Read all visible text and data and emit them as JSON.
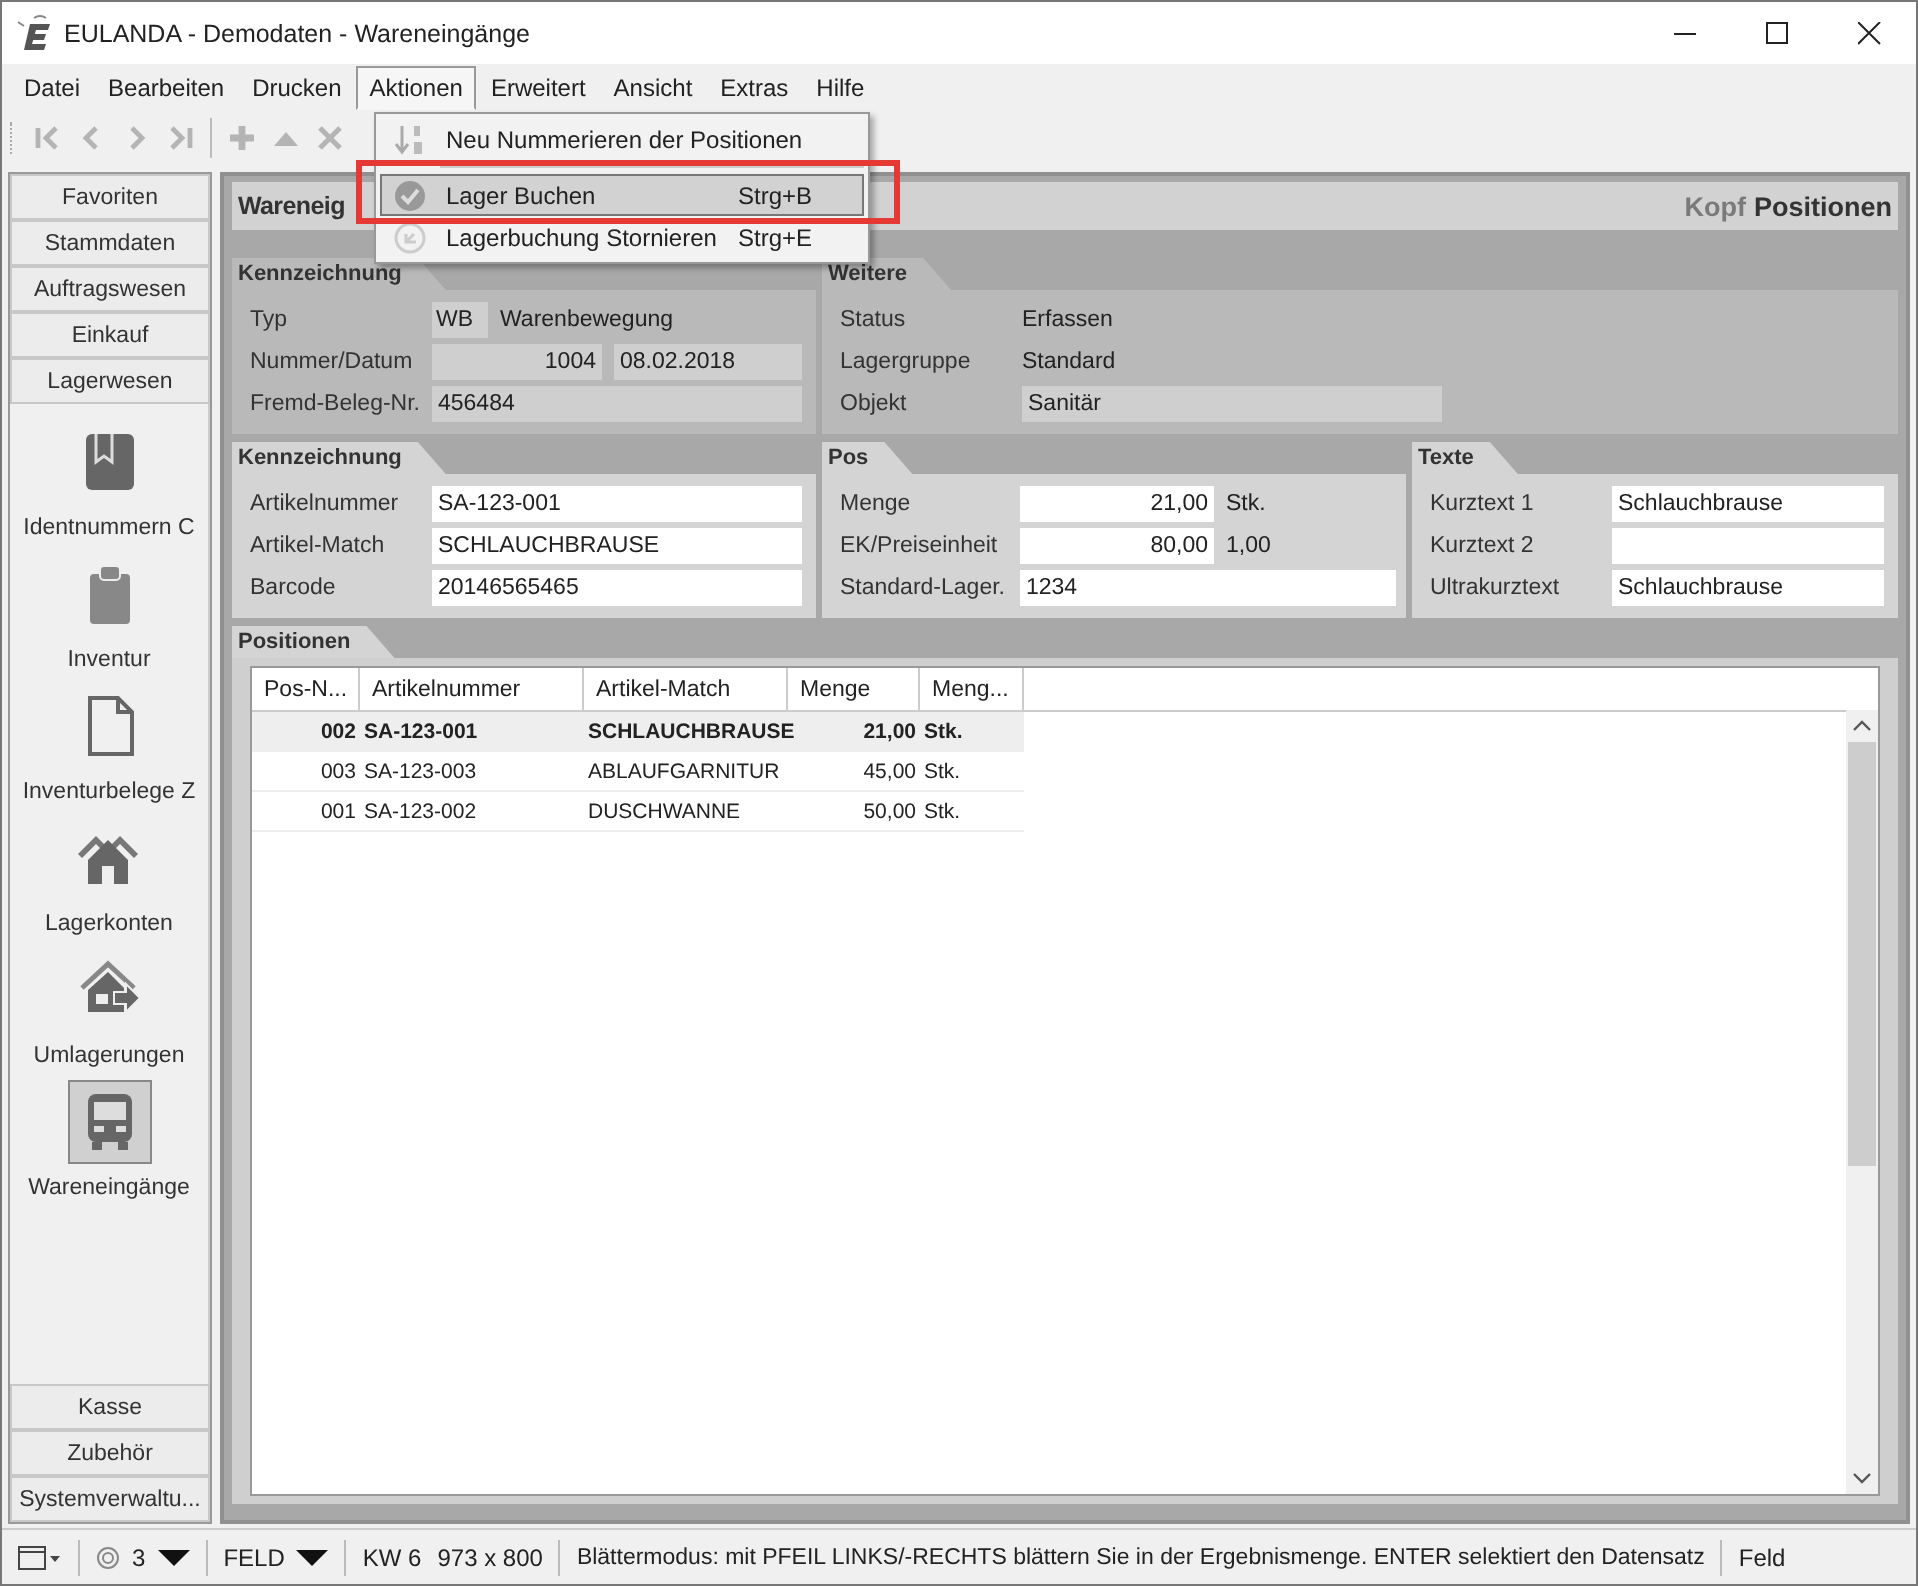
{
  "window": {
    "title": "EULANDA - Demodaten - Wareneingänge"
  },
  "menu": [
    {
      "label": "Datei",
      "selected": false
    },
    {
      "label": "Bearbeiten",
      "selected": false
    },
    {
      "label": "Drucken",
      "selected": false
    },
    {
      "label": "Aktionen",
      "selected": true
    },
    {
      "label": "Erweitert",
      "selected": false
    },
    {
      "label": "Ansicht",
      "selected": false
    },
    {
      "label": "Extras",
      "selected": false
    },
    {
      "label": "Hilfe",
      "selected": false
    }
  ],
  "dropdown": [
    {
      "kind": "item",
      "label": "Neu Nummerieren der Positionen",
      "selected": false
    },
    {
      "kind": "separator"
    },
    {
      "kind": "item",
      "label": "Lager Buchen",
      "shortcut": "Strg+B",
      "selected": true
    },
    {
      "kind": "item",
      "label": "Lagerbuchung Stornieren",
      "shortcut": "Strg+E",
      "selected": false
    }
  ],
  "toolbar": [
    {
      "kind": "first",
      "disabled": true
    },
    {
      "kind": "prev",
      "disabled": true
    },
    {
      "kind": "next",
      "disabled": true
    },
    {
      "kind": "last",
      "disabled": true
    },
    {
      "kind": "separator"
    },
    {
      "kind": "add",
      "disabled": true
    },
    {
      "kind": "up",
      "disabled": true
    },
    {
      "kind": "delete",
      "disabled": true
    }
  ],
  "sidebar": {
    "top_categories": [
      "Favoriten",
      "Stammdaten",
      "Auftragswesen",
      "Einkauf",
      "Lagerwesen"
    ],
    "items": [
      {
        "label": "Identnummern C",
        "kind": "tag",
        "selected": false
      },
      {
        "label": "Inventur",
        "kind": "clipboard",
        "selected": false
      },
      {
        "label": "Inventurbelege Z",
        "kind": "document",
        "selected": false
      },
      {
        "label": "Lagerkonten",
        "kind": "houses",
        "selected": false
      },
      {
        "label": "Umlagerungen",
        "kind": "transfer",
        "selected": false
      },
      {
        "label": "Wareneingänge",
        "kind": "truck",
        "selected": true
      }
    ],
    "bottom_categories": [
      "Kasse",
      "Zubehör",
      "Systemverwaltu..."
    ]
  },
  "main": {
    "title": "Wareneig",
    "view_tabs": [
      {
        "label": "Kopf",
        "selected": false
      },
      {
        "label": "Positionen",
        "selected": true
      }
    ],
    "header_panels": [
      {
        "title": "Kennzeichnung",
        "fields": [
          {
            "label": "Typ",
            "values": [
              {
                "kind": "box",
                "text": "WB"
              },
              {
                "kind": "text",
                "text": "Warenbewegung"
              }
            ]
          },
          {
            "label": "Nummer/Datum",
            "values": [
              {
                "kind": "readonly-number",
                "text": "1004"
              },
              {
                "kind": "readonly",
                "text": "08.02.2018"
              }
            ]
          },
          {
            "label": "Fremd-Beleg-Nr.",
            "values": [
              {
                "kind": "readonly",
                "text": "456484"
              }
            ]
          }
        ]
      },
      {
        "title": "Weitere",
        "fields": [
          {
            "label": "Status",
            "values": [
              {
                "kind": "text",
                "text": "Erfassen"
              }
            ]
          },
          {
            "label": "Lagergruppe",
            "values": [
              {
                "kind": "text",
                "text": "Standard"
              }
            ]
          },
          {
            "label": "Objekt",
            "values": [
              {
                "kind": "readonly",
                "text": "Sanitär"
              }
            ]
          }
        ]
      }
    ],
    "detail_panels": [
      {
        "title": "Kennzeichnung",
        "fields": [
          {
            "label": "Artikelnummer",
            "values": [
              {
                "kind": "input",
                "text": "SA-123-001"
              }
            ]
          },
          {
            "label": "Artikel-Match",
            "values": [
              {
                "kind": "input",
                "text": "SCHLAUCHBRAUSE"
              }
            ]
          },
          {
            "label": "Barcode",
            "values": [
              {
                "kind": "input",
                "text": "20146565465"
              }
            ]
          }
        ]
      },
      {
        "title": "Pos",
        "fields": [
          {
            "label": "Menge",
            "values": [
              {
                "kind": "input-number",
                "text": "21,00"
              },
              {
                "kind": "text",
                "text": "Stk."
              }
            ]
          },
          {
            "label": "EK/Preiseinheit",
            "values": [
              {
                "kind": "input-number",
                "text": "80,00"
              },
              {
                "kind": "text",
                "text": "1,00"
              }
            ]
          },
          {
            "label": "Standard-Lager.",
            "values": [
              {
                "kind": "input",
                "text": "1234"
              }
            ]
          }
        ]
      },
      {
        "title": "Texte",
        "fields": [
          {
            "label": "Kurztext 1",
            "values": [
              {
                "kind": "input",
                "text": "Schlauchbrause"
              }
            ]
          },
          {
            "label": "Kurztext 2",
            "values": [
              {
                "kind": "input"
              }
            ]
          },
          {
            "label": "Ultrakurztext",
            "values": [
              {
                "kind": "input",
                "text": "Schlauchbrause"
              }
            ]
          }
        ]
      }
    ],
    "positions": {
      "title": "Positionen",
      "columns": [
        {
          "label": "Pos-N...",
          "kind": "number"
        },
        {
          "label": "Artikelnummer",
          "kind": "text"
        },
        {
          "label": "Artikel-Match",
          "kind": "text"
        },
        {
          "label": "Menge",
          "kind": "number"
        },
        {
          "label": "Meng...",
          "kind": "text"
        }
      ],
      "rows": [
        {
          "selected": true,
          "cells": [
            "002",
            "SA-123-001",
            "SCHLAUCHBRAUSE",
            "21,00",
            "Stk."
          ]
        },
        {
          "selected": false,
          "cells": [
            "003",
            "SA-123-003",
            "ABLAUFGARNITUR",
            "45,00",
            "Stk."
          ]
        },
        {
          "selected": false,
          "cells": [
            "001",
            "SA-123-002",
            "DUSCHWANNE",
            "50,00",
            "Stk."
          ]
        }
      ]
    }
  },
  "status_bar": {
    "count": "3",
    "mode": "FELD",
    "week": "KW 6",
    "size": "973 x 800",
    "message": "Blättermodus: mit PFEIL LINKS/-RECHTS blättern Sie in der Ergebnismenge. ENTER selektiert den Datensatz",
    "field": "Feld"
  }
}
